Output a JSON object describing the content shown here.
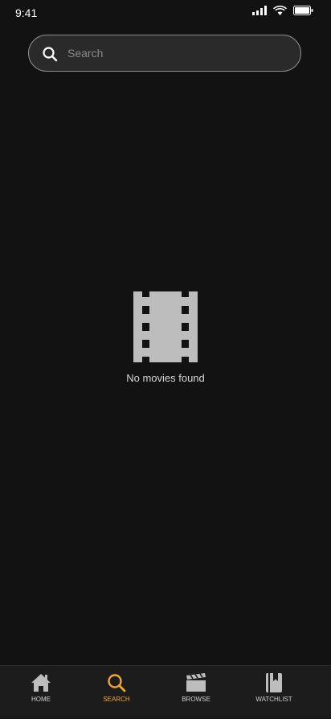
{
  "status_bar": {
    "time": "9:41"
  },
  "search": {
    "placeholder": "Search",
    "value": ""
  },
  "empty_state": {
    "icon": "film-icon",
    "message": "No movies found"
  },
  "bottom_nav": {
    "active": "search",
    "items": [
      {
        "id": "home",
        "label": "HOME",
        "icon": "home-icon"
      },
      {
        "id": "search",
        "label": "SEARCH",
        "icon": "search-icon"
      },
      {
        "id": "browse",
        "label": "BROWSE",
        "icon": "clapperboard-icon"
      },
      {
        "id": "watchlist",
        "label": "WATCHLIST",
        "icon": "bookmark-book-icon"
      }
    ]
  },
  "colors": {
    "background": "#121212",
    "accent": "#f5a623",
    "nav_background": "#1c1c1c",
    "icon_gray": "#bdbdbd"
  }
}
